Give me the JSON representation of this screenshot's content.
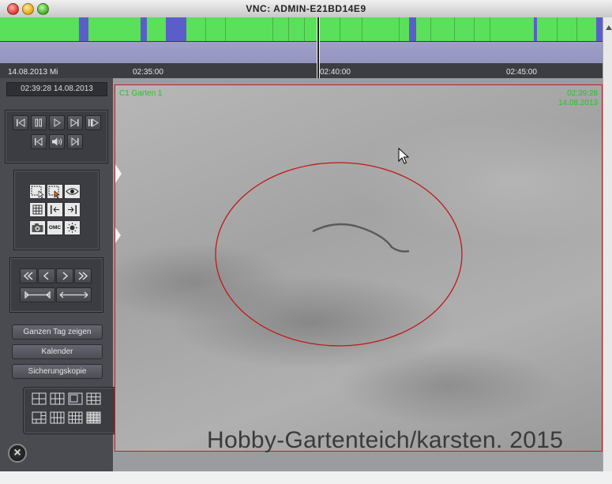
{
  "window": {
    "title": "VNC: ADMIN-E21BD14E9"
  },
  "timeline": {
    "date_label": "14.08.2013 Mi",
    "time_labels": [
      "02:35:00",
      "02:40:00",
      "02:45:00"
    ]
  },
  "sidebar": {
    "clock": "02:39:28 14.08.2013",
    "buttons": {
      "full_day": "Ganzen Tag zeigen",
      "calendar": "Kalender",
      "backup": "Sicherungskopie"
    },
    "ptz_label": "OMC"
  },
  "video": {
    "camera_name": "C1 Garten 1",
    "time": "02:39:28",
    "date": "14.08.2013"
  },
  "watermark": "Hobby-Gartenteich/karsten. 2015",
  "colors": {
    "timeline_green": "#5ae05a",
    "timeline_blue": "#5b5ec8",
    "osd_green": "#22c822",
    "frame_red": "#c02020"
  }
}
